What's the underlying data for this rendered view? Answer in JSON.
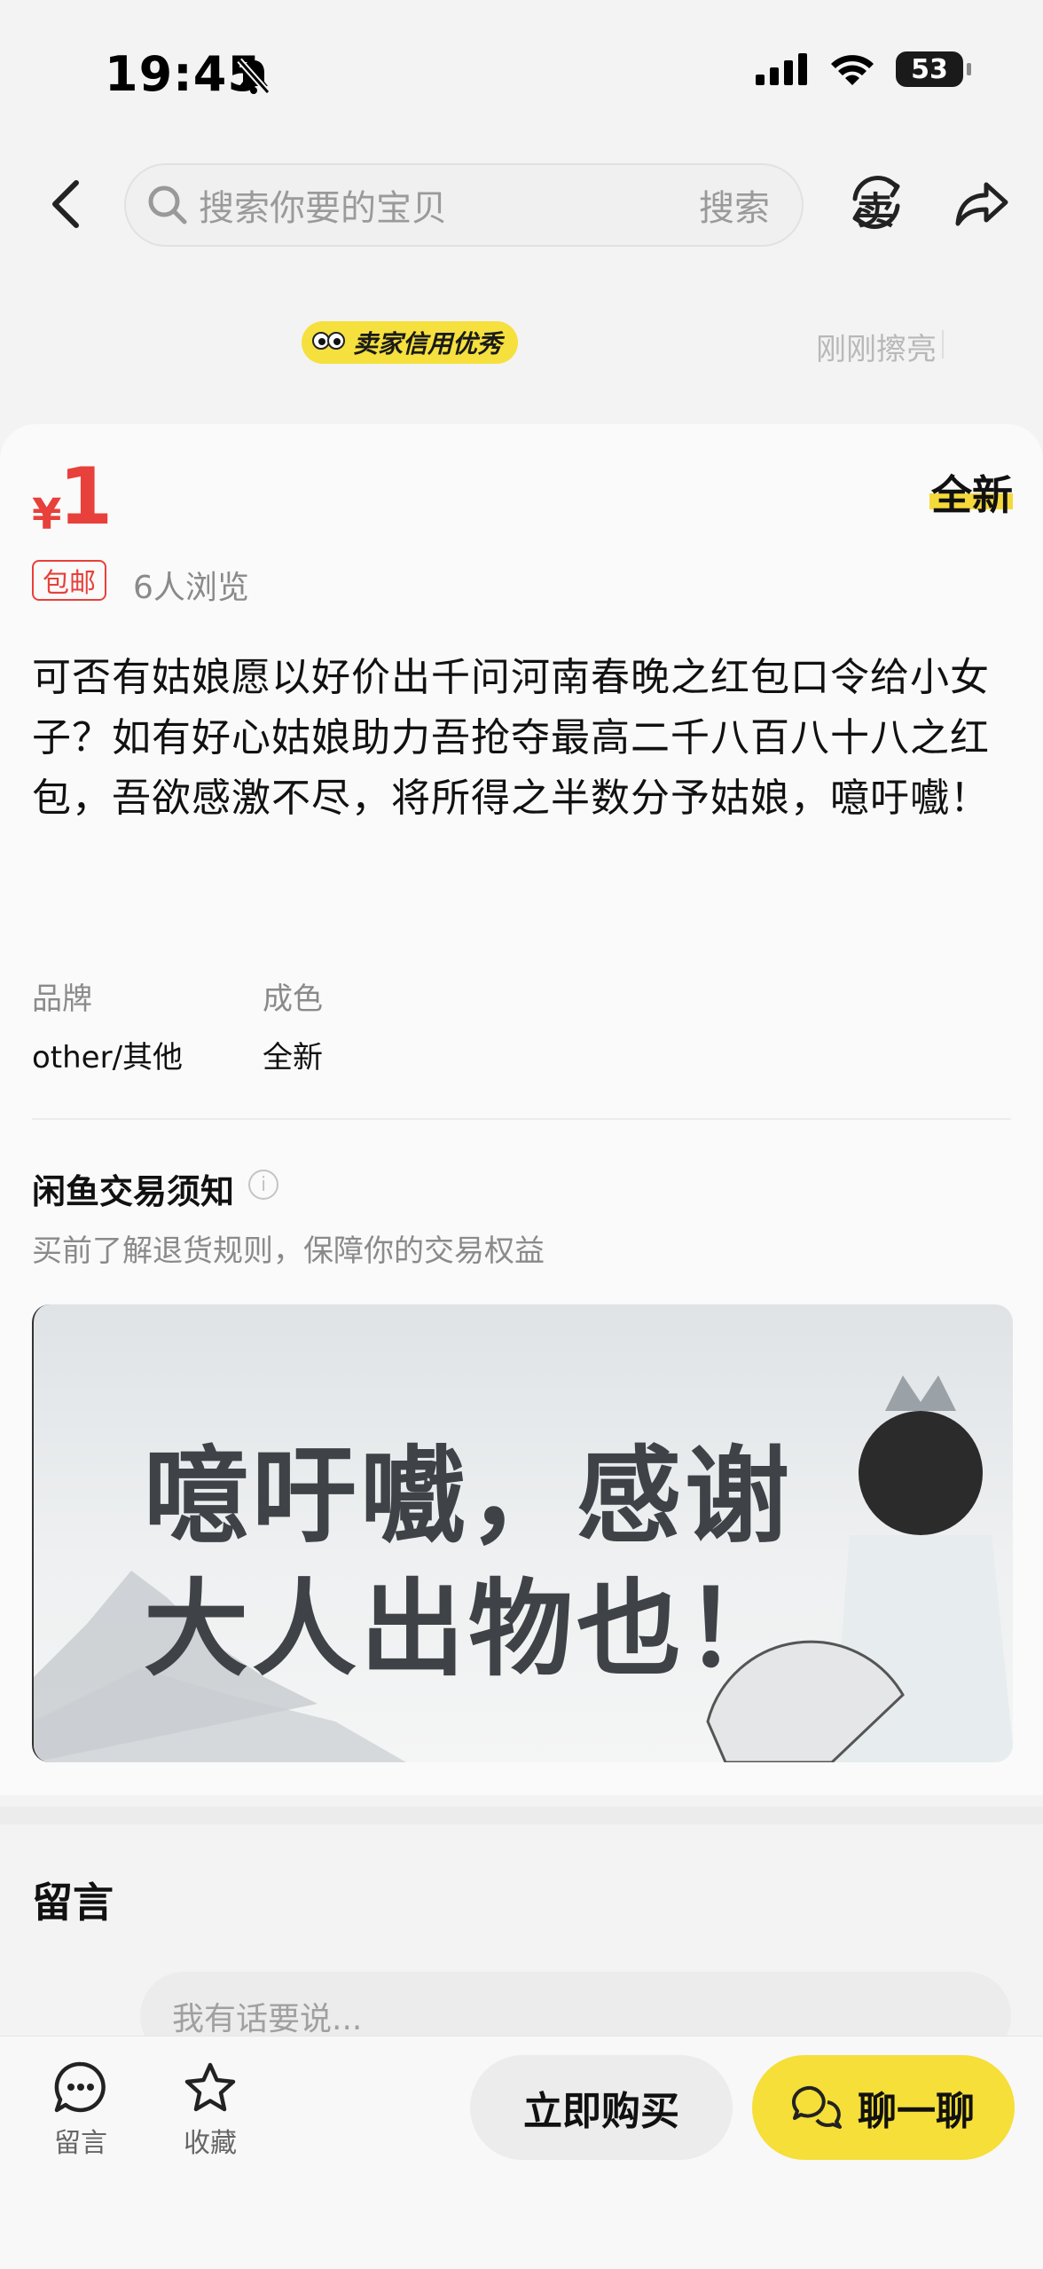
{
  "status": {
    "time": "19:45",
    "battery": "53"
  },
  "nav": {
    "search_placeholder": "搜索你要的宝贝",
    "search_button": "搜索",
    "sell_icon_char": "卖"
  },
  "seller": {
    "credit_badge": "卖家信用优秀",
    "refresh_status": "刚刚擦亮"
  },
  "product": {
    "price_symbol": "¥",
    "price": "1",
    "condition_tag": "全新",
    "shipping_tag": "包邮",
    "views": "6人浏览",
    "description": "可否有姑娘愿以好价出千问河南春晚之红包口令给小女子？如有好心姑娘助力吾抢夺最高二千八百八十八之红包，吾欲感激不尽，将所得之半数分予姑娘，噫吁嚱！",
    "attributes": [
      {
        "label": "品牌",
        "value": "other/其他"
      },
      {
        "label": "成色",
        "value": "全新"
      }
    ]
  },
  "notice": {
    "title": "闲鱼交易须知",
    "subtitle": "买前了解退货规则，保障你的交易权益",
    "info_icon_char": "i"
  },
  "banner": {
    "line1": "噫吁嚱，感谢",
    "line2": "大人出物也！"
  },
  "comments": {
    "title": "留言",
    "input_placeholder": "我有话要说..."
  },
  "bottom": {
    "comment_label": "留言",
    "favorite_label": "收藏",
    "buy_label": "立即购买",
    "chat_label": "聊一聊"
  },
  "colors": {
    "accent_yellow": "#f5df38",
    "price_red": "#e8403a"
  }
}
